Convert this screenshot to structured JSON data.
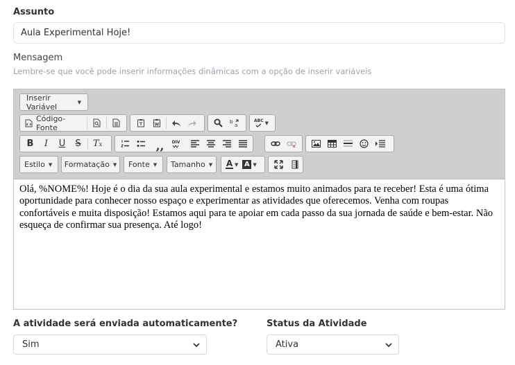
{
  "subject": {
    "label": "Assunto",
    "value": "Aula Experimental Hoje!"
  },
  "message": {
    "label": "Mensagem",
    "hint": "Lembre-se que você pode inserir informações dinâmicas com a opção de inserir variáveis"
  },
  "toolbar": {
    "insert_variable": "Inserir Variável",
    "source_code": "Código-Fonte",
    "style": "Estilo",
    "format": "Formatação",
    "font": "Fonte",
    "size": "Tamanho",
    "bold": "B",
    "italic": "I",
    "underline": "U",
    "strike": "S",
    "clear_format": "T",
    "spell": "ABC",
    "div": "DIV",
    "text_color_letter": "A",
    "bg_color_letter": "A",
    "bg_color": "#ffffff",
    "accent_dark": "#333333"
  },
  "editor": {
    "content": "Olá, %NOME%! Hoje é o dia da sua aula experimental e estamos muito animados para te receber! Esta é uma ótima oportunidade para conhecer nosso espaço e experimentar as atividades que oferecemos. Venha com roupas confortáveis e muita disposição! Estamos aqui para te apoiar em cada passo da sua jornada de saúde e bem-estar. Não esqueça de confirmar sua presença. Até logo!"
  },
  "auto_send": {
    "label": "A atividade será enviada automaticamente?",
    "value": "Sim"
  },
  "status": {
    "label": "Status da Atividade",
    "value": "Ativa"
  }
}
